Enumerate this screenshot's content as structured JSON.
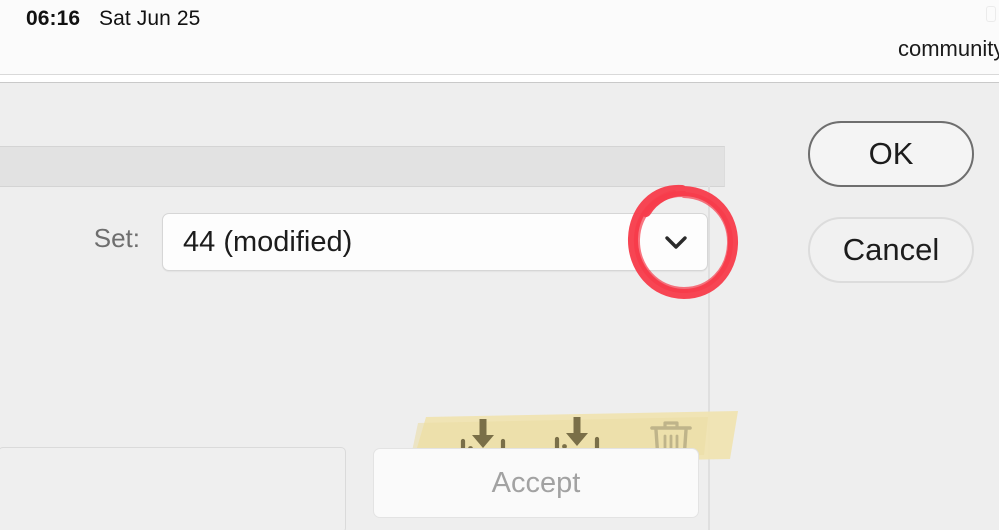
{
  "menubar": {
    "clock": "06:16",
    "date": "Sat Jun 25",
    "right_text": "community",
    "corner_icon": "partial-menu-extra-icon"
  },
  "dialog": {
    "set_row": {
      "label": "Set:",
      "combo_value": "44 (modified)",
      "combo_arrow_icon": "chevron-down-icon"
    },
    "toolbar": {
      "icons": [
        {
          "name": "save-icon",
          "label": "Save"
        },
        {
          "name": "save-as-icon",
          "label": "Save As…"
        },
        {
          "name": "delete-icon",
          "label": "Delete"
        }
      ]
    },
    "accept_button": "Accept",
    "ok_button": "OK",
    "cancel_button": "Cancel"
  },
  "annotations": {
    "circle": {
      "name": "red-circle-annotation",
      "target": "combo-dropdown-arrow",
      "color": "#f73b4a"
    },
    "highlight": {
      "name": "yellow-highlight-annotation",
      "target": "icon-toolbar",
      "color": "#f0e3b0"
    }
  },
  "colors": {
    "window_background": "#eeeeee",
    "menubar_background": "#fbfbfb",
    "toolbar_band": "#e2e2e2",
    "field_background": "#fdfdfd",
    "icon_ink": "#7a6f48",
    "icon_ink_disabled": "#bfb48a",
    "disabled_text": "#a2a2a2"
  }
}
